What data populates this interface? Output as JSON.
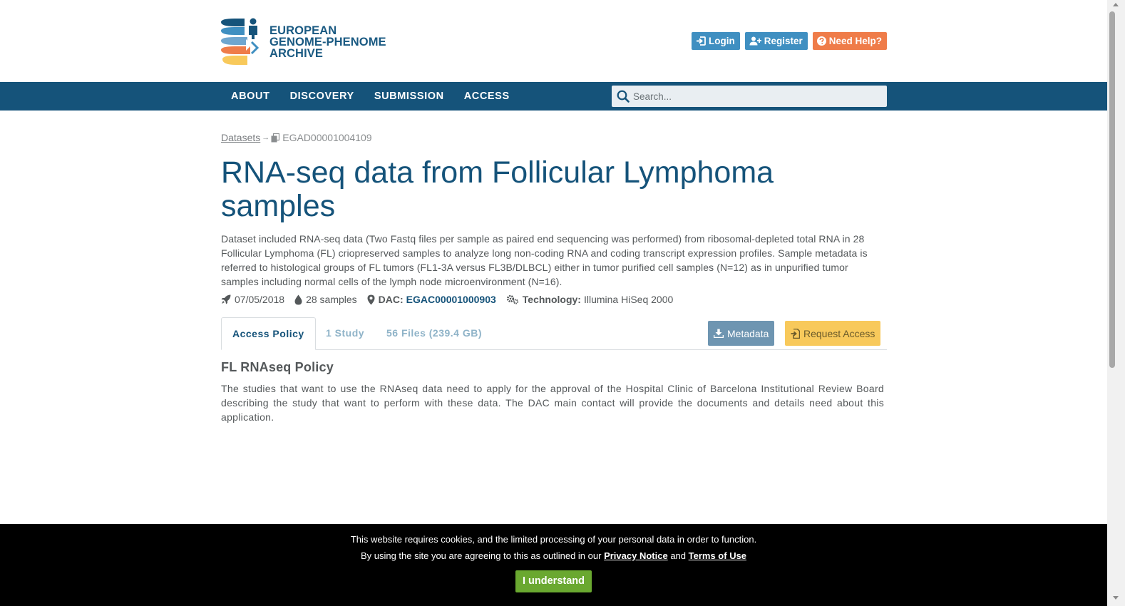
{
  "header": {
    "logo_lines": [
      "EUROPEAN",
      "GENOME-PHENOME",
      "ARCHIVE"
    ],
    "login_label": "Login",
    "register_label": "Register",
    "help_label": "Need Help?"
  },
  "nav": {
    "items": [
      {
        "label": "ABOUT"
      },
      {
        "label": "DISCOVERY"
      },
      {
        "label": "SUBMISSION"
      },
      {
        "label": "ACCESS"
      }
    ],
    "search_placeholder": "Search..."
  },
  "breadcrumb": {
    "parent": "Datasets",
    "separator": "→",
    "current": "EGAD00001004109"
  },
  "dataset": {
    "title": "RNA-seq data from Follicular Lymphoma samples",
    "description": "Dataset included RNA-seq data (Two Fastq files per sample as paired end sequencing was performed) from ribosomal-depleted total RNA in 28 Follicular Lymphoma (FL) criopreserved samples to analyze long non-coding RNA and coding transcript expression profiles. Sample metadata is referred to histological groups of FL tumors (FL1-3A versus FL3B/DLBCL) either in tumor purified cell samples (N=12) as in unpurified tumor samples including normal cells of the lymph node microenvironment (N=16).",
    "date": "07/05/2018",
    "samples": "28 samples",
    "dac_label": "DAC:",
    "dac_id": "EGAC00001000903",
    "technology_label": "Technology:",
    "technology_value": "Illumina HiSeq 2000"
  },
  "tabs": [
    {
      "label": "Access Policy",
      "active": true
    },
    {
      "label": "1 Study",
      "active": false
    },
    {
      "label": "56 Files (239.4 GB)",
      "active": false
    }
  ],
  "actions": {
    "metadata_label": "Metadata",
    "request_label": "Request Access"
  },
  "policy": {
    "title": "FL RNAseq Policy",
    "text": "The studies that want to use the RNAseq data need to apply for the approval of  the Hospital Clinic of Barcelona Institutional Review Board describing the study that want to perform with these data. The DAC main contact will provide the documents and details need about this application."
  },
  "cookie": {
    "line1": "This website requires cookies, and the limited processing of your personal data in order to function.",
    "line2_prefix": "By using the site you are agreeing to this as outlined in our",
    "privacy_label": "Privacy Notice",
    "and_label": "and",
    "terms_label": "Terms of Use",
    "button_label": "I understand"
  },
  "colors": {
    "brand_blue": "#15537a",
    "button_blue": "#3f8fc1",
    "button_orange": "#ef7c49",
    "request_yellow": "#f8c95b",
    "cookie_green": "#6aa830"
  }
}
